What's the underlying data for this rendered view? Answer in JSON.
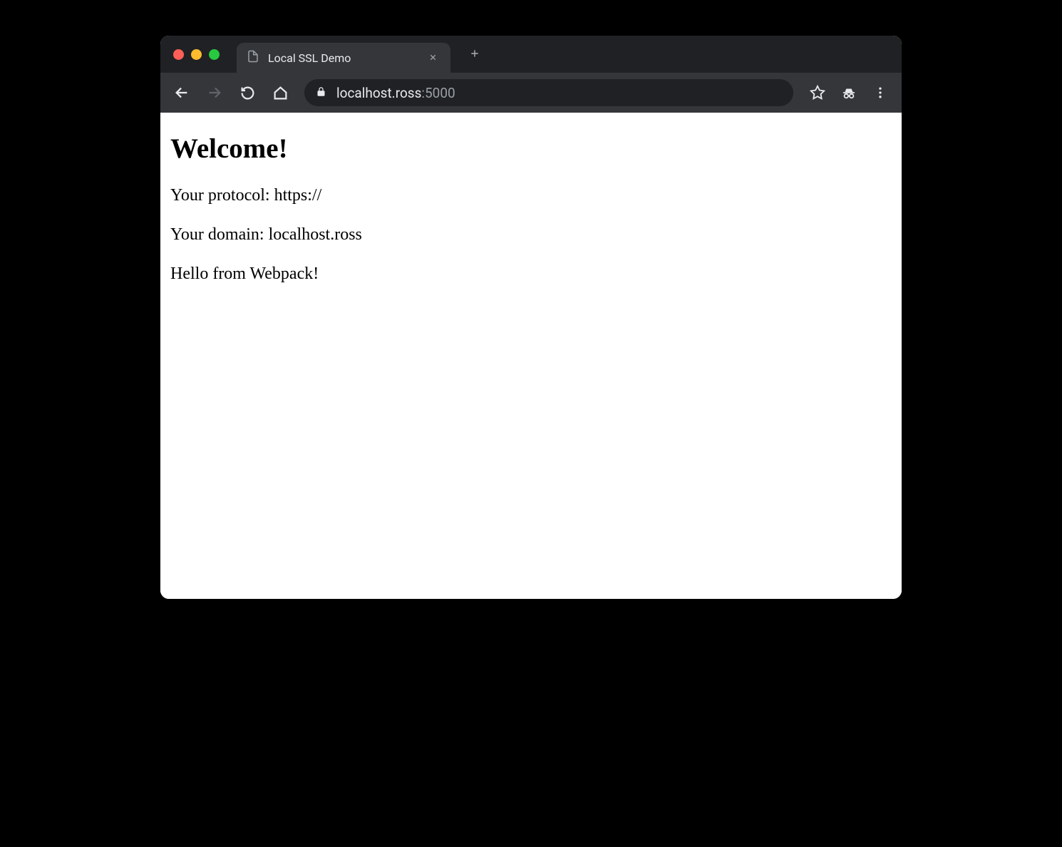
{
  "tab": {
    "title": "Local SSL Demo"
  },
  "url": {
    "host": "localhost.ross",
    "port": ":5000"
  },
  "page": {
    "heading": "Welcome!",
    "protocol_line": "Your protocol: https://",
    "domain_line": "Your domain: localhost.ross",
    "hello_line": "Hello from Webpack!"
  }
}
